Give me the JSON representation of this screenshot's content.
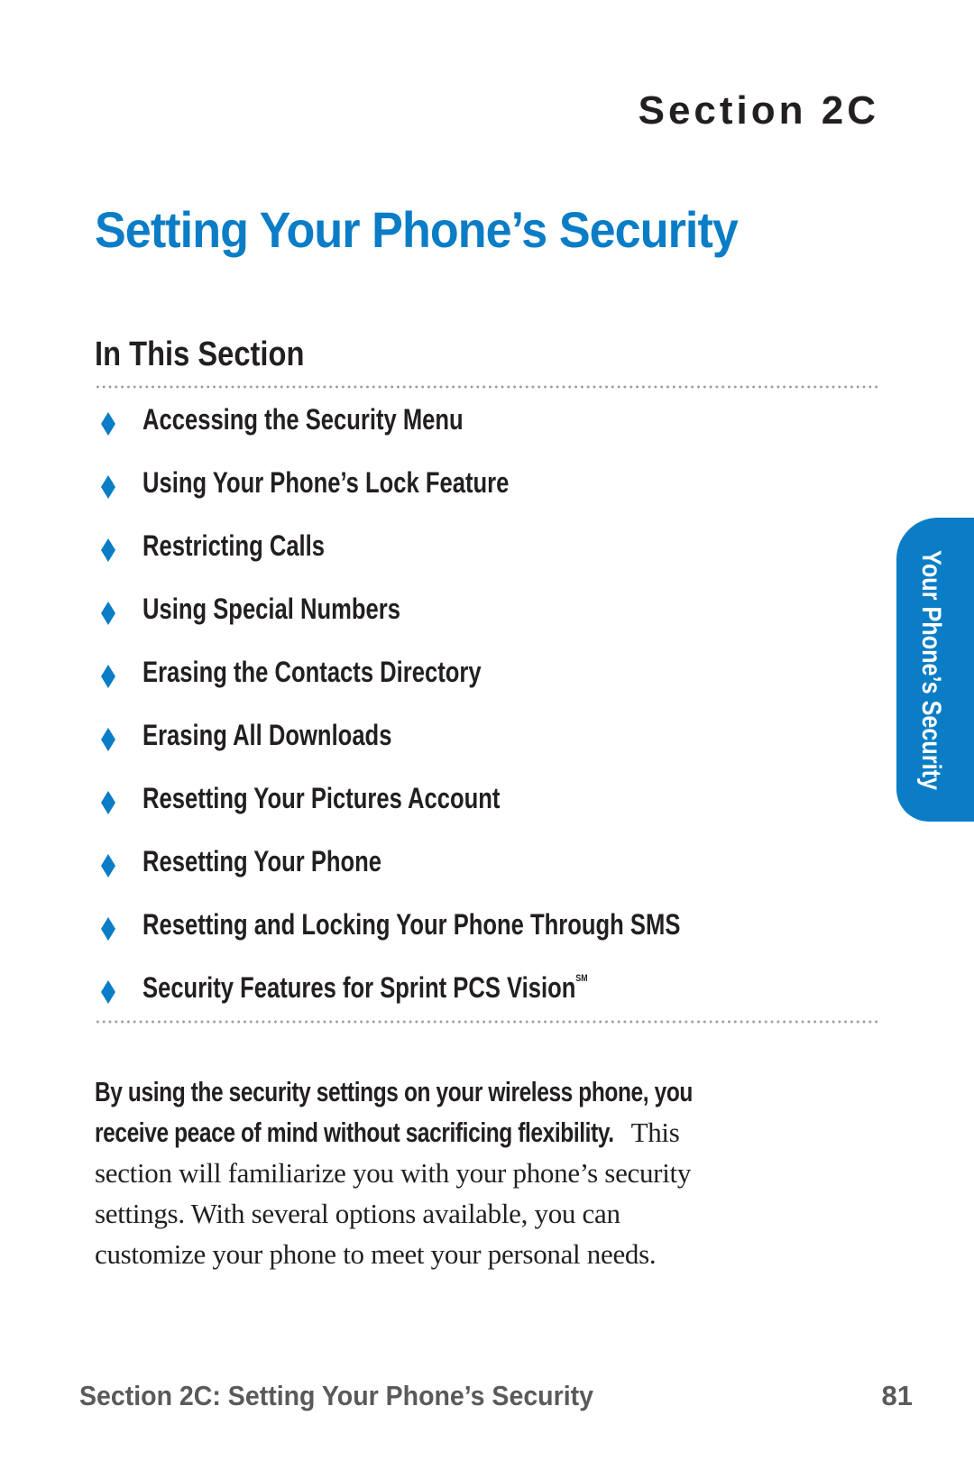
{
  "header": {
    "section_label": "Section 2C",
    "page_title": "Setting Your Phone’s Security"
  },
  "in_this_section": {
    "heading": "In This Section",
    "bullet_icon": "diamond-bullet-icon",
    "items": [
      {
        "label": "Accessing the Security Menu",
        "superscript": ""
      },
      {
        "label": "Using Your Phone’s Lock Feature",
        "superscript": ""
      },
      {
        "label": "Restricting Calls",
        "superscript": ""
      },
      {
        "label": "Using Special Numbers",
        "superscript": ""
      },
      {
        "label": "Erasing the Contacts Directory",
        "superscript": ""
      },
      {
        "label": "Erasing All Downloads",
        "superscript": ""
      },
      {
        "label": "Resetting Your Pictures Account",
        "superscript": ""
      },
      {
        "label": "Resetting Your Phone",
        "superscript": ""
      },
      {
        "label": "Resetting and Locking Your Phone Through SMS",
        "superscript": ""
      },
      {
        "label": "Security Features for Sprint PCS Vision",
        "superscript": "SM"
      }
    ]
  },
  "intro": {
    "bold_line_1": "By using the security settings on your wireless phone, you",
    "bold_line_2": "receive peace of mind without sacrificing flexibility.",
    "regular_line_2": " This",
    "regular_line_3": "section will familiarize you with your phone’s security",
    "regular_line_4": "settings. With several options available, you can",
    "regular_line_5": "customize your phone to meet your personal needs."
  },
  "side_tab": {
    "label": "Your Phone’s Security"
  },
  "footer": {
    "running_title": "Section 2C: Setting Your Phone’s Security",
    "page_number": "81"
  },
  "colors": {
    "accent_blue": "#0a7dc6",
    "text_dark": "#231f20",
    "footer_gray": "#595a5c",
    "dotted_rule_gray": "#9a9ea3"
  }
}
